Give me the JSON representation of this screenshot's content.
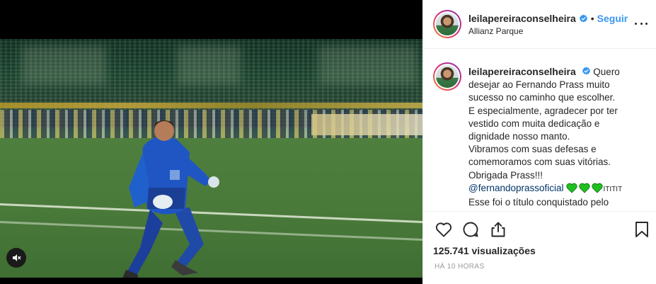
{
  "post": {
    "username": "leilapereiraconselheira",
    "follow_label": "Seguir",
    "separator": "•",
    "location": "Allianz Parque",
    "more_icon": "more-horizontal-icon"
  },
  "caption": {
    "username": "leilapereiraconselheira",
    "text_lines": [
      "Quero",
      "desejar ao Fernando Prass muito",
      "sucesso no caminho que escolher.",
      "E especialmente, agradecer por ter",
      "vestido com muita dedicação e",
      "dignidade nosso manto.",
      "Vibramos com suas defesas e",
      "comemoramos com suas vitórias.",
      "Obrigada Prass!!!"
    ],
    "mention": "@fernandoprassoficial",
    "hearts_count": 3,
    "heart_color": "#1fbf1f",
    "suffix": "ITITIT",
    "last_line": "Esse foi o título conquistado pelo"
  },
  "actions": {
    "like_icon": "heart-icon",
    "comment_icon": "comment-icon",
    "share_icon": "share-icon",
    "save_icon": "bookmark-icon"
  },
  "stats": {
    "views": "125.741 visualizações",
    "time": "HÁ 10 HORAS"
  },
  "colors": {
    "link_blue": "#3897f0",
    "mention_blue": "#003569",
    "verified_blue": "#3897f0",
    "text": "#262626",
    "muted": "#999999"
  }
}
